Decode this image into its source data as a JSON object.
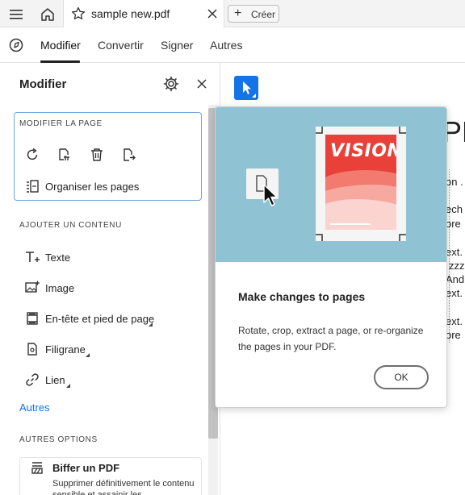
{
  "titlebar": {
    "tab_title": "sample new.pdf",
    "create_label": "Créer"
  },
  "menubar": {
    "items": [
      "Modifier",
      "Convertir",
      "Signer",
      "Autres"
    ],
    "active": "Modifier"
  },
  "panel": {
    "title": "Modifier",
    "modify_page": {
      "header": "MODIFIER LA PAGE",
      "tools": [
        "rotate-icon",
        "crop-page-icon",
        "delete-icon",
        "extract-page-icon"
      ],
      "organize_label": "Organiser les pages"
    },
    "add_content": {
      "header": "AJOUTER UN CONTENU",
      "items": [
        {
          "label": "Texte",
          "icon": "text-add-icon"
        },
        {
          "label": "Image",
          "icon": "image-add-icon"
        },
        {
          "label": "En-tête et pied de page",
          "icon": "header-footer-icon"
        },
        {
          "label": "Filigrane",
          "icon": "watermark-icon"
        },
        {
          "label": "Lien",
          "icon": "link-icon"
        }
      ],
      "more_link": "Autres"
    },
    "other_options": {
      "header": "AUTRES OPTIONS",
      "card_title": "Biffer un PDF",
      "card_desc": "Supprimer définitivement le contenu sensible et assainir les"
    }
  },
  "document": {
    "big_text": "PD",
    "lines": [
      "on .",
      "ech",
      "ore",
      "ext.",
      "zzz",
      "And",
      "ext.",
      "ext.",
      "ore"
    ]
  },
  "popup": {
    "poster_text": "VISION",
    "title": "Make changes to pages",
    "description": "Rotate, crop, extract a page, or re-organize the pages in your PDF.",
    "ok_label": "OK"
  },
  "colors": {
    "accent": "#1473e6",
    "hero_bg": "#8fc3d3",
    "section_border": "#6fa6dd"
  }
}
